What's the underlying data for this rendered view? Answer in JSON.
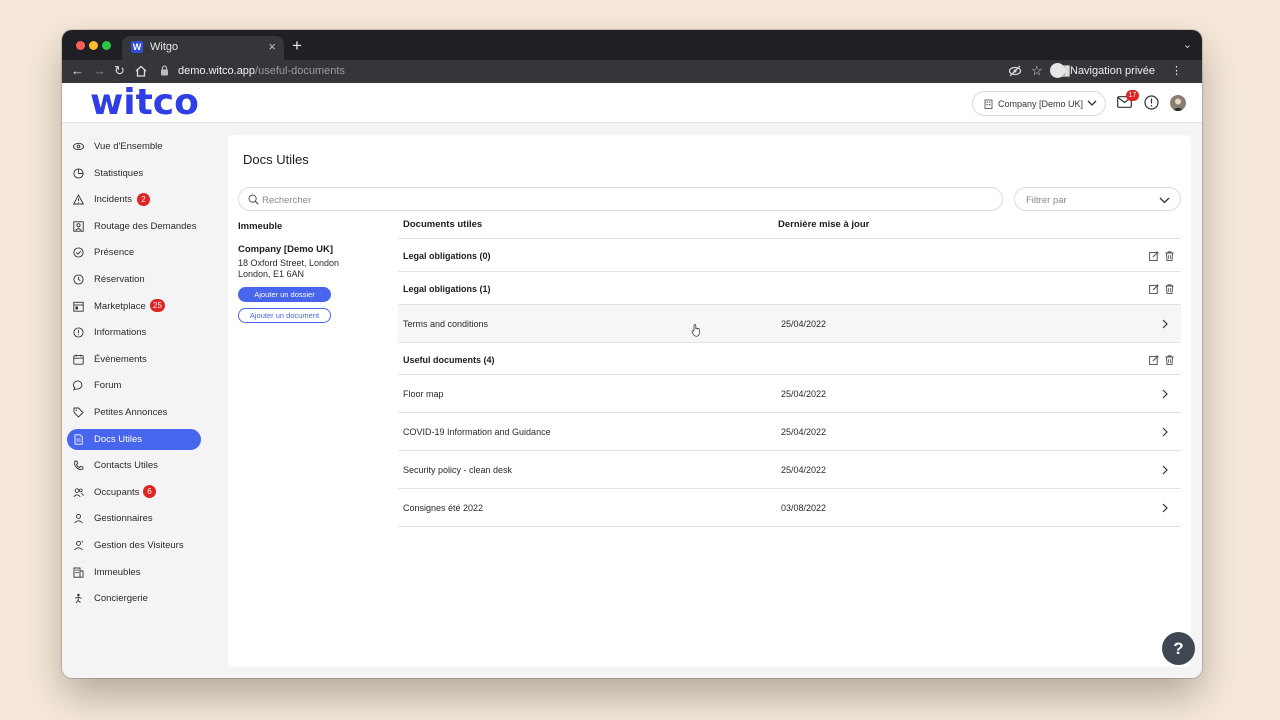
{
  "browser": {
    "tab_title": "Witgo",
    "tab_favicon": "W",
    "new_tab": "+",
    "tab_close": "×",
    "url_host": "demo.witco.app",
    "url_path": "/useful-documents",
    "profile_label": "Navigation privée",
    "traffic_colors": [
      "#ff5f57",
      "#febc2e",
      "#28c840"
    ]
  },
  "header": {
    "logo_text": "witco",
    "company_selector": "Company [Demo UK]",
    "mail_count": "17"
  },
  "sidebar": {
    "items": [
      {
        "label": "Vue d'Ensemble",
        "icon": "eye-icon"
      },
      {
        "label": "Statistiques",
        "icon": "pie-chart-icon"
      },
      {
        "label": "Incidents",
        "icon": "warning-icon",
        "badge": "2"
      },
      {
        "label": "Routage des Demandes",
        "icon": "user-square-icon"
      },
      {
        "label": "Présence",
        "icon": "check-circle-icon"
      },
      {
        "label": "Réservation",
        "icon": "clock-icon"
      },
      {
        "label": "Marketplace",
        "icon": "store-icon",
        "badge": "25"
      },
      {
        "label": "Informations",
        "icon": "info-circle-icon"
      },
      {
        "label": "Évènements",
        "icon": "calendar-icon"
      },
      {
        "label": "Forum",
        "icon": "chat-bubble-icon"
      },
      {
        "label": "Petites Annonces",
        "icon": "tag-icon"
      },
      {
        "label": "Docs Utiles",
        "icon": "document-icon",
        "active": true
      },
      {
        "label": "Contacts Utiles",
        "icon": "phone-icon"
      },
      {
        "label": "Occupants",
        "icon": "users-icon",
        "badge": "6"
      },
      {
        "label": "Gestionnaires",
        "icon": "user-icon"
      },
      {
        "label": "Gestion des Visiteurs",
        "icon": "visitor-icon"
      },
      {
        "label": "Immeubles",
        "icon": "building-icon"
      },
      {
        "label": "Conciergerie",
        "icon": "concierge-icon"
      }
    ]
  },
  "main": {
    "title": "Docs Utiles",
    "search_placeholder": "Rechercher",
    "filter_placeholder": "Filtrer par",
    "columns": {
      "building": "Immeuble",
      "documents": "Documents utiles",
      "updated": "Dernière mise à jour"
    },
    "building": {
      "name": "Company [Demo UK]",
      "address_line1": "18 Oxford Street, London",
      "address_line2": "London, E1 6AN",
      "add_folder": "Ajouter un dossier",
      "add_document": "Ajouter un document"
    },
    "folders": [
      {
        "name": "Legal obligations (0)",
        "docs": []
      },
      {
        "name": "Legal obligations (1)",
        "docs": [
          {
            "name": "Terms and conditions",
            "date": "25/04/2022"
          }
        ]
      },
      {
        "name": "Useful documents (4)",
        "docs": [
          {
            "name": "Floor map",
            "date": "25/04/2022"
          },
          {
            "name": "COVID-19 Information and Guidance",
            "date": "25/04/2022"
          },
          {
            "name": "Security policy - clean desk",
            "date": "25/04/2022"
          },
          {
            "name": "Consignes été 2022",
            "date": "03/08/2022"
          }
        ]
      }
    ]
  },
  "help_label": "?",
  "colors": {
    "accent": "#4865ee",
    "logo": "#2f3ee6",
    "badge": "#e02424"
  }
}
